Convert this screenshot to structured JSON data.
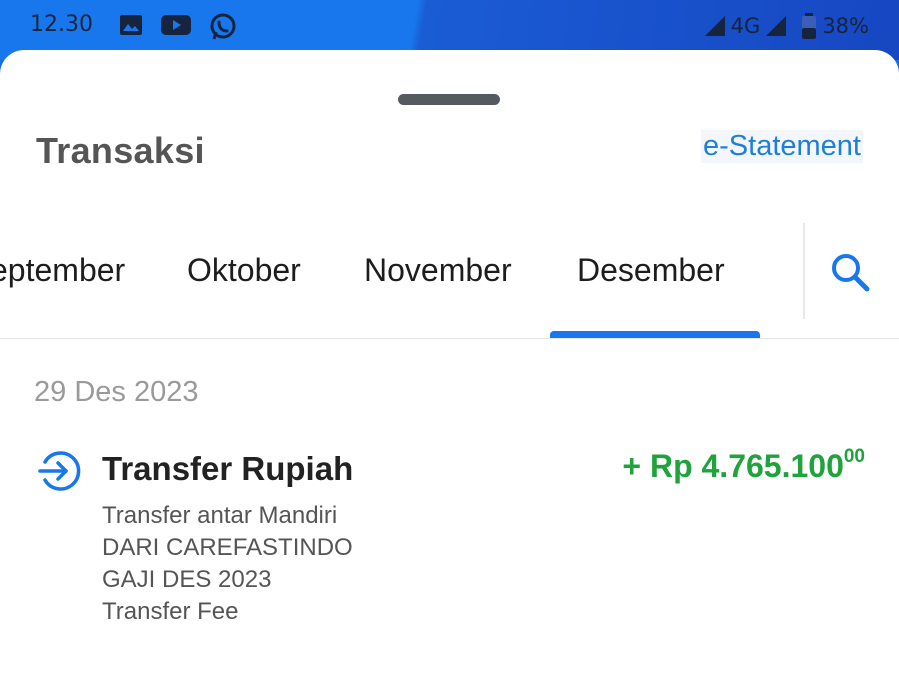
{
  "status_bar": {
    "time": "12.30",
    "notification_icons": [
      "image-icon",
      "youtube-icon",
      "whatsapp-icon"
    ],
    "network": "4G",
    "battery": "38%"
  },
  "sheet": {
    "title": "Transaksi",
    "estatement_label": "e-Statement"
  },
  "months": {
    "items": [
      "eptember",
      "Oktober",
      "November",
      "Desember"
    ],
    "selected": "Desember",
    "accent_color": "#1877ec"
  },
  "transactions": {
    "date": "29 Des 2023",
    "item": {
      "title": "Transfer Rupiah",
      "amount_main": "+ Rp 4.765.100",
      "amount_cents": "00",
      "amount_color": "#1fa33c",
      "details": [
        "Transfer antar Mandiri",
        "DARI CAREFASTINDO",
        "GAJI DES 2023",
        "Transfer Fee"
      ]
    }
  }
}
